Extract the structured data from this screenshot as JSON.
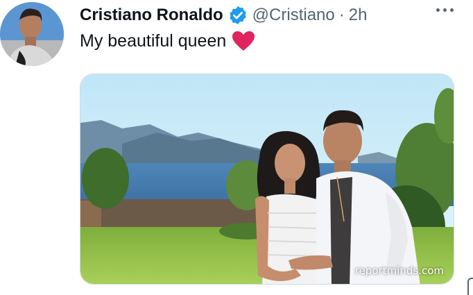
{
  "tweet": {
    "author_name": "Cristiano Ronaldo",
    "handle": "@Cristiano",
    "separator": "·",
    "time": "2h",
    "text": "My beautiful queen",
    "emoji": "red-heart",
    "media_watermark": "reportminds.com"
  },
  "colors": {
    "verified": "#1d9bf0",
    "heart": "#e0245e",
    "text": "#0f1419",
    "secondary": "#536471"
  },
  "icons": {
    "verified": "verified-badge-icon",
    "more": "more-options-icon",
    "heart": "heart-emoji-icon"
  }
}
